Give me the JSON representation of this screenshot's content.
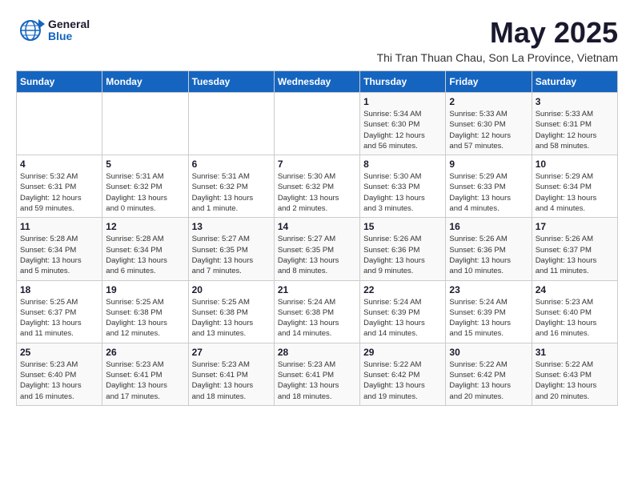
{
  "logo": {
    "text_general": "General",
    "text_blue": "Blue"
  },
  "title": "May 2025",
  "subtitle": "Thi Tran Thuan Chau, Son La Province, Vietnam",
  "headers": [
    "Sunday",
    "Monday",
    "Tuesday",
    "Wednesday",
    "Thursday",
    "Friday",
    "Saturday"
  ],
  "weeks": [
    [
      {
        "day": "",
        "info": ""
      },
      {
        "day": "",
        "info": ""
      },
      {
        "day": "",
        "info": ""
      },
      {
        "day": "",
        "info": ""
      },
      {
        "day": "1",
        "info": "Sunrise: 5:34 AM\nSunset: 6:30 PM\nDaylight: 12 hours\nand 56 minutes."
      },
      {
        "day": "2",
        "info": "Sunrise: 5:33 AM\nSunset: 6:30 PM\nDaylight: 12 hours\nand 57 minutes."
      },
      {
        "day": "3",
        "info": "Sunrise: 5:33 AM\nSunset: 6:31 PM\nDaylight: 12 hours\nand 58 minutes."
      }
    ],
    [
      {
        "day": "4",
        "info": "Sunrise: 5:32 AM\nSunset: 6:31 PM\nDaylight: 12 hours\nand 59 minutes."
      },
      {
        "day": "5",
        "info": "Sunrise: 5:31 AM\nSunset: 6:32 PM\nDaylight: 13 hours\nand 0 minutes."
      },
      {
        "day": "6",
        "info": "Sunrise: 5:31 AM\nSunset: 6:32 PM\nDaylight: 13 hours\nand 1 minute."
      },
      {
        "day": "7",
        "info": "Sunrise: 5:30 AM\nSunset: 6:32 PM\nDaylight: 13 hours\nand 2 minutes."
      },
      {
        "day": "8",
        "info": "Sunrise: 5:30 AM\nSunset: 6:33 PM\nDaylight: 13 hours\nand 3 minutes."
      },
      {
        "day": "9",
        "info": "Sunrise: 5:29 AM\nSunset: 6:33 PM\nDaylight: 13 hours\nand 4 minutes."
      },
      {
        "day": "10",
        "info": "Sunrise: 5:29 AM\nSunset: 6:34 PM\nDaylight: 13 hours\nand 4 minutes."
      }
    ],
    [
      {
        "day": "11",
        "info": "Sunrise: 5:28 AM\nSunset: 6:34 PM\nDaylight: 13 hours\nand 5 minutes."
      },
      {
        "day": "12",
        "info": "Sunrise: 5:28 AM\nSunset: 6:34 PM\nDaylight: 13 hours\nand 6 minutes."
      },
      {
        "day": "13",
        "info": "Sunrise: 5:27 AM\nSunset: 6:35 PM\nDaylight: 13 hours\nand 7 minutes."
      },
      {
        "day": "14",
        "info": "Sunrise: 5:27 AM\nSunset: 6:35 PM\nDaylight: 13 hours\nand 8 minutes."
      },
      {
        "day": "15",
        "info": "Sunrise: 5:26 AM\nSunset: 6:36 PM\nDaylight: 13 hours\nand 9 minutes."
      },
      {
        "day": "16",
        "info": "Sunrise: 5:26 AM\nSunset: 6:36 PM\nDaylight: 13 hours\nand 10 minutes."
      },
      {
        "day": "17",
        "info": "Sunrise: 5:26 AM\nSunset: 6:37 PM\nDaylight: 13 hours\nand 11 minutes."
      }
    ],
    [
      {
        "day": "18",
        "info": "Sunrise: 5:25 AM\nSunset: 6:37 PM\nDaylight: 13 hours\nand 11 minutes."
      },
      {
        "day": "19",
        "info": "Sunrise: 5:25 AM\nSunset: 6:38 PM\nDaylight: 13 hours\nand 12 minutes."
      },
      {
        "day": "20",
        "info": "Sunrise: 5:25 AM\nSunset: 6:38 PM\nDaylight: 13 hours\nand 13 minutes."
      },
      {
        "day": "21",
        "info": "Sunrise: 5:24 AM\nSunset: 6:38 PM\nDaylight: 13 hours\nand 14 minutes."
      },
      {
        "day": "22",
        "info": "Sunrise: 5:24 AM\nSunset: 6:39 PM\nDaylight: 13 hours\nand 14 minutes."
      },
      {
        "day": "23",
        "info": "Sunrise: 5:24 AM\nSunset: 6:39 PM\nDaylight: 13 hours\nand 15 minutes."
      },
      {
        "day": "24",
        "info": "Sunrise: 5:23 AM\nSunset: 6:40 PM\nDaylight: 13 hours\nand 16 minutes."
      }
    ],
    [
      {
        "day": "25",
        "info": "Sunrise: 5:23 AM\nSunset: 6:40 PM\nDaylight: 13 hours\nand 16 minutes."
      },
      {
        "day": "26",
        "info": "Sunrise: 5:23 AM\nSunset: 6:41 PM\nDaylight: 13 hours\nand 17 minutes."
      },
      {
        "day": "27",
        "info": "Sunrise: 5:23 AM\nSunset: 6:41 PM\nDaylight: 13 hours\nand 18 minutes."
      },
      {
        "day": "28",
        "info": "Sunrise: 5:23 AM\nSunset: 6:41 PM\nDaylight: 13 hours\nand 18 minutes."
      },
      {
        "day": "29",
        "info": "Sunrise: 5:22 AM\nSunset: 6:42 PM\nDaylight: 13 hours\nand 19 minutes."
      },
      {
        "day": "30",
        "info": "Sunrise: 5:22 AM\nSunset: 6:42 PM\nDaylight: 13 hours\nand 20 minutes."
      },
      {
        "day": "31",
        "info": "Sunrise: 5:22 AM\nSunset: 6:43 PM\nDaylight: 13 hours\nand 20 minutes."
      }
    ]
  ]
}
